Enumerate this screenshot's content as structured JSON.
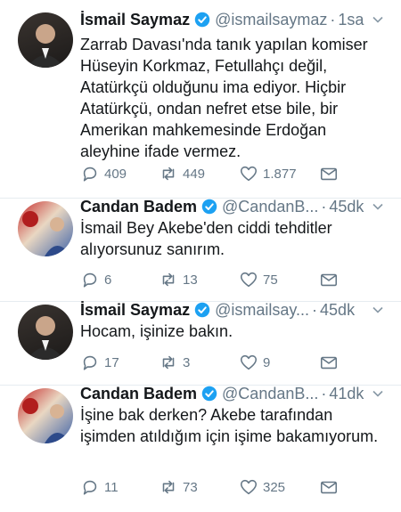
{
  "tweets": [
    {
      "name": "İsmail Saymaz",
      "handle": "@ismailsaymaz",
      "dot": "·",
      "time": "1sa",
      "text": "Zarrab Davası'nda tanık yapılan komiser Hüseyin Korkmaz, Fetullahçı değil, Atatürkçü olduğunu ima ediyor. Hiçbir Atatürkçü, ondan nefret etse bile, bir Amerikan mahkemesinde Erdoğan aleyhine ifade vermez.",
      "replies": "409",
      "retweets": "449",
      "likes": "1.877"
    },
    {
      "name": "Candan Badem",
      "handle": "@CandanB...",
      "dot": "·",
      "time": "45dk",
      "text": "İsmail Bey Akebe'den ciddi tehditler alıyorsunuz sanırım.",
      "replies": "6",
      "retweets": "13",
      "likes": "75"
    },
    {
      "name": "İsmail Saymaz",
      "handle": "@ismailsay...",
      "dot": "·",
      "time": "45dk",
      "text": "Hocam, işinize bakın.",
      "replies": "17",
      "retweets": "3",
      "likes": "9"
    },
    {
      "name": "Candan Badem",
      "handle": "@CandanB...",
      "dot": "·",
      "time": "41dk",
      "text": "İşine bak derken? Akebe tarafından işimden atıldığım için işime bakamıyorum.",
      "replies": "11",
      "retweets": "73",
      "likes": "325"
    }
  ],
  "colors": {
    "verified": "#1da1f2",
    "secondary_text": "#657786",
    "divider": "#e6ecf0"
  },
  "icons": [
    "verified-icon",
    "caret-down-icon",
    "reply-icon",
    "retweet-icon",
    "like-icon",
    "direct-message-icon"
  ]
}
